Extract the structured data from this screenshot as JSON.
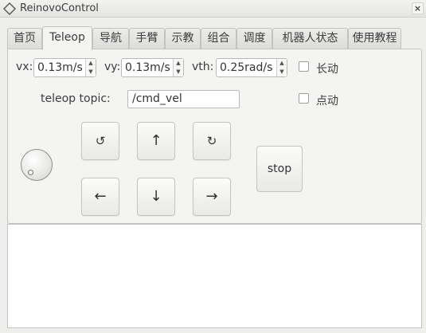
{
  "window": {
    "title": "ReinovoControl",
    "close_label": "×"
  },
  "tabs": [
    {
      "label": "首页",
      "active": false
    },
    {
      "label": "Teleop",
      "active": true
    },
    {
      "label": "导航",
      "active": false
    },
    {
      "label": "手臂",
      "active": false
    },
    {
      "label": "示教",
      "active": false
    },
    {
      "label": "组合",
      "active": false
    },
    {
      "label": "调度",
      "active": false
    },
    {
      "label": "机器人状态",
      "active": false
    },
    {
      "label": "使用教程",
      "active": false
    }
  ],
  "teleop": {
    "vx": {
      "label": "vx:",
      "value": "0.13m/s"
    },
    "vy": {
      "label": "vy:",
      "value": "0.13m/s"
    },
    "vth": {
      "label": "vth:",
      "value": "0.25rad/s"
    },
    "continuous_label": "长动",
    "continuous_checked": false,
    "inching_label": "点动",
    "inching_checked": false,
    "topic_label": "teleop topic:",
    "topic_value": "/cmd_vel",
    "spin_up_glyph": "▲",
    "spin_down_glyph": "▼",
    "buttons": {
      "rotate_left": "↺",
      "forward": "↑",
      "rotate_right": "↻",
      "left": "←",
      "backward": "↓",
      "right": "→",
      "stop": "stop"
    }
  },
  "log": {
    "text": ""
  }
}
